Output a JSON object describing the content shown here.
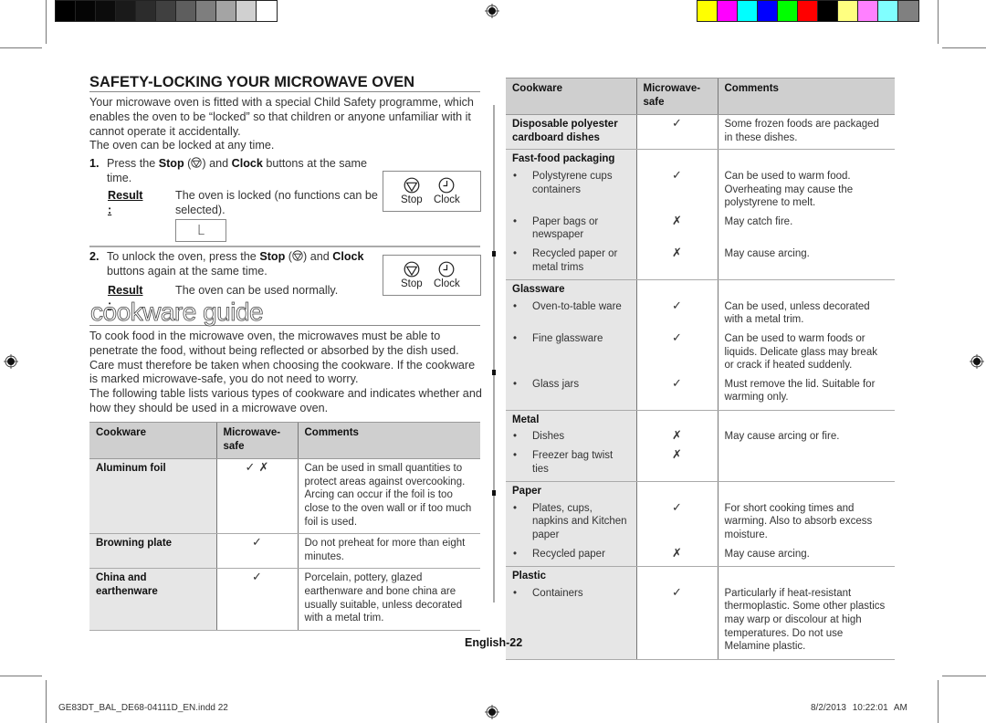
{
  "print_marks": {
    "gray_swatches": [
      "#000000",
      "#050505",
      "#0c0c0c",
      "#1a1a1a",
      "#2c2c2c",
      "#404040",
      "#5e5e5e",
      "#7e7e7e",
      "#a4a4a4",
      "#d0d0d0",
      "#ffffff"
    ],
    "color_swatches": [
      "#ffff00",
      "#ff00ff",
      "#00ffff",
      "#0000ff",
      "#00ff00",
      "#ff0000",
      "#000000",
      "#ffff80",
      "#ff80ff",
      "#80ffff",
      "#808080"
    ],
    "registration_icon": "crosshair-target-icon"
  },
  "safety": {
    "heading": "SAFETY-LOCKING YOUR MICROWAVE OVEN",
    "intro": "Your microwave oven is fitted with a special Child Safety programme, which enables the oven to be “locked” so that children or anyone unfamiliar with it cannot operate it accidentally.",
    "intro2": "The oven can be locked at any time.",
    "step1": {
      "num": "1.",
      "pre": "Press the ",
      "stop": "Stop",
      "mid": " and ",
      "clock": "Clock",
      "post": " buttons at the same time.",
      "result_label": "Result :",
      "result_text": "The oven is locked (no functions can be selected).",
      "display_char": "L"
    },
    "step2": {
      "num": "2.",
      "pre": "To unlock the oven, press the ",
      "stop": "Stop",
      "mid": " and ",
      "clock": "Clock",
      "post": " buttons again at the same time.",
      "result_label": "Result :",
      "result_text": "The oven can be used normally."
    },
    "panel": {
      "stop_label": "Stop",
      "clock_label": "Clock"
    }
  },
  "guide": {
    "heading": "cookware guide",
    "para1": "To cook food in the microwave oven, the microwaves must be able to penetrate the food, without being reflected or absorbed by the dish used. Care must therefore be taken when choosing the cookware. If the cookware is marked microwave-safe, you do not need to worry.",
    "para2": "The following table lists various types of cookware and indicates whether and how they should be used in a microwave oven."
  },
  "table_headers": {
    "cookware": "Cookware",
    "safe": "Microwave-safe",
    "comments": "Comments"
  },
  "table_left": [
    {
      "cookware": "Aluminum foil",
      "safe": "✓ ✗",
      "comments": "Can be used in small quantities to protect areas against overcooking. Arcing can occur if the foil is too close to the oven wall or if too much foil is used."
    },
    {
      "cookware": "Browning plate",
      "safe": "✓",
      "comments": "Do not preheat for more than eight minutes."
    },
    {
      "cookware": "China and earthenware",
      "safe": "✓",
      "comments": "Porcelain, pottery, glazed earthenware and bone china are usually suitable, unless decorated with a metal trim."
    }
  ],
  "table_right": {
    "disposable": {
      "cookware": "Disposable polyester cardboard dishes",
      "safe": "✓",
      "comments": "Some frozen foods are packaged in these dishes."
    },
    "groups": [
      {
        "title": "Fast-food packaging",
        "items": [
          {
            "cookware": "Polystyrene cups containers",
            "safe": "✓",
            "comments": "Can be used to warm food. Overheating may cause the polystyrene to melt."
          },
          {
            "cookware": "Paper bags or newspaper",
            "safe": "✗",
            "comments": "May catch fire."
          },
          {
            "cookware": "Recycled paper or metal trims",
            "safe": "✗",
            "comments": "May cause arcing."
          }
        ]
      },
      {
        "title": "Glassware",
        "items": [
          {
            "cookware": "Oven-to-table ware",
            "safe": "✓",
            "comments": "Can be used, unless decorated with a metal trim."
          },
          {
            "cookware": "Fine glassware",
            "safe": "✓",
            "comments": "Can be used to warm foods or liquids. Delicate glass may break or crack if heated suddenly."
          },
          {
            "cookware": "Glass jars",
            "safe": "✓",
            "comments": "Must remove the lid. Suitable for warming only."
          }
        ]
      },
      {
        "title": "Metal",
        "items": [
          {
            "cookware": "Dishes",
            "safe": "✗",
            "comments": "May cause arcing or fire."
          },
          {
            "cookware": "Freezer bag twist ties",
            "safe": "✗",
            "comments": ""
          }
        ]
      },
      {
        "title": "Paper",
        "items": [
          {
            "cookware": "Plates, cups, napkins and Kitchen paper",
            "safe": "✓",
            "comments": "For short cooking times and warming. Also to absorb excess moisture."
          },
          {
            "cookware": "Recycled paper",
            "safe": "✗",
            "comments": "May cause arcing."
          }
        ]
      },
      {
        "title": "Plastic",
        "items": [
          {
            "cookware": "Containers",
            "safe": "✓",
            "comments": "Particularly if heat-resistant thermoplastic. Some other plastics may warp or discolour at high temperatures. Do not use Melamine plastic."
          }
        ]
      }
    ],
    "bullet": "•"
  },
  "footer": {
    "page_label": "English-22",
    "file_info": "GE83DT_BAL_DE68-04111D_EN.indd   22",
    "timestamp": "8/2/2013   10:22:01 AM"
  }
}
